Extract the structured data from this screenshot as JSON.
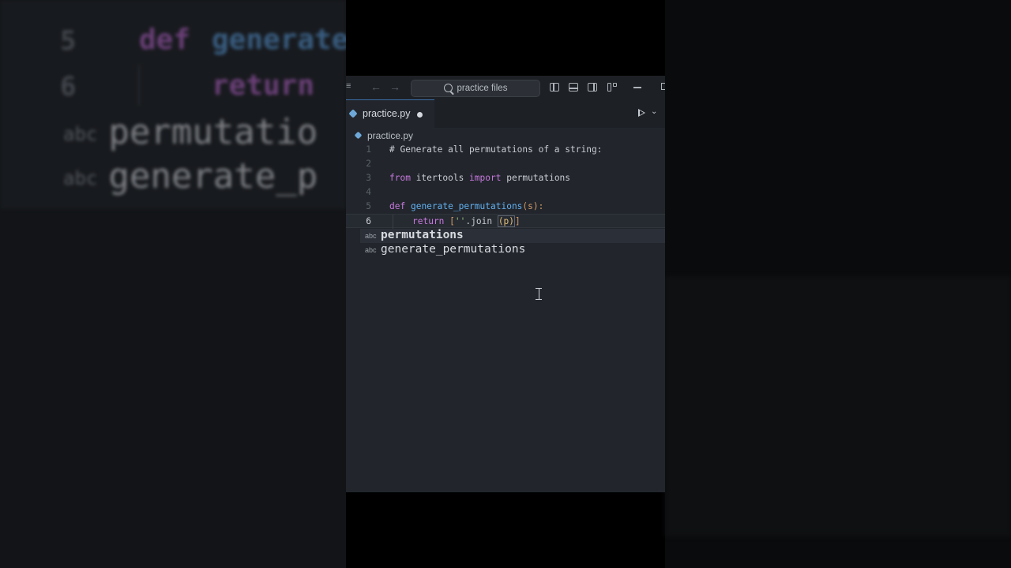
{
  "background_zoom": {
    "line5_num": "5",
    "line6_num": "6",
    "line5_kw": "def",
    "line5_fn": "generate",
    "line6_kw": "return",
    "sug1": "permutatio",
    "sug2": "generate_p",
    "abc": "abc"
  },
  "titlebar": {
    "search_placeholder": "practice files"
  },
  "tab": {
    "filename": "practice.py"
  },
  "breadcrumb": {
    "file": "practice.py"
  },
  "code": {
    "lines": [
      {
        "num": "1",
        "text": "# Generate all permutations of a string:"
      },
      {
        "num": "2",
        "text": ""
      },
      {
        "num": "3",
        "kw1": "from",
        "mod": " itertools ",
        "kw2": "import",
        "name": " permutations"
      },
      {
        "num": "4",
        "text": ""
      },
      {
        "num": "5",
        "kw": "def",
        "fn": "generate_permutations",
        "rest": "(s):"
      },
      {
        "num": "6",
        "kw": "return",
        "p1": " [",
        "str": "''",
        "p2": ".join ",
        "arg": "(p)",
        "p3": "]"
      }
    ]
  },
  "suggestions": [
    {
      "kind": "abc",
      "label": "permutations"
    },
    {
      "kind": "abc",
      "label": "generate_permutations"
    }
  ]
}
